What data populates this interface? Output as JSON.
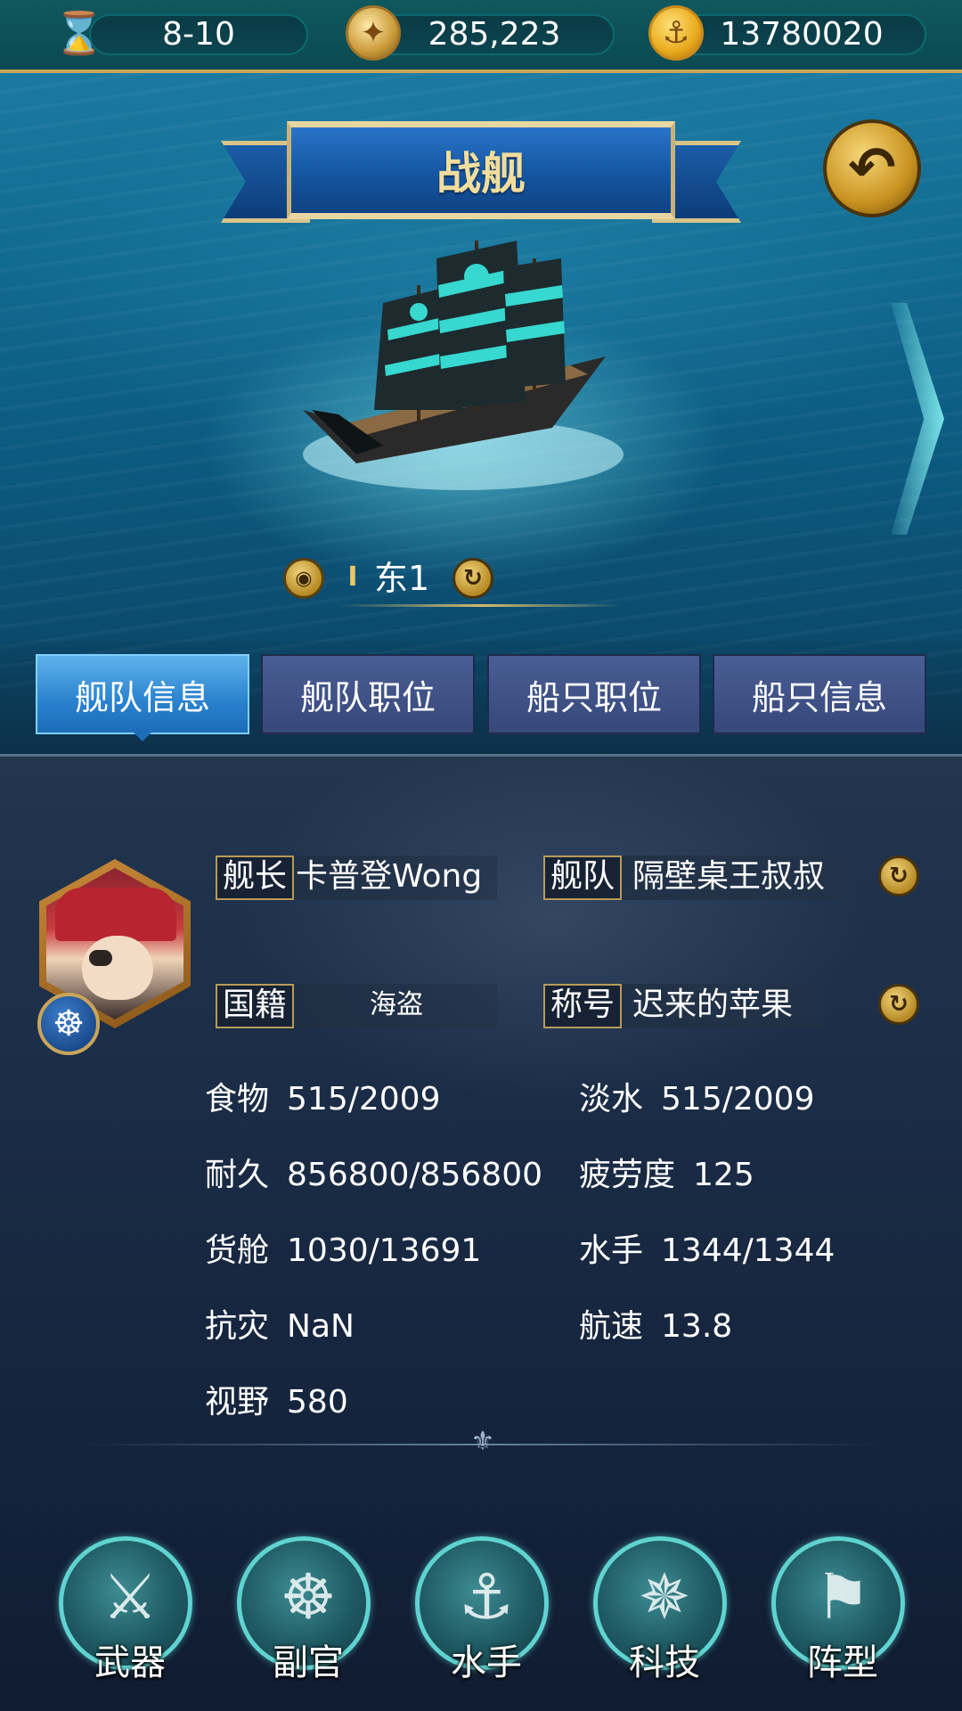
{
  "top_bar": {
    "resources": [
      {
        "icon": "hourglass-icon",
        "value": "8-10"
      },
      {
        "icon": "compass-icon",
        "value": "285,223"
      },
      {
        "icon": "anchor-coin-icon",
        "value": "13780020"
      }
    ]
  },
  "header": {
    "title": "战舰",
    "back_icon": "back-arrow-icon"
  },
  "ship": {
    "name": "东1",
    "rank_mark": "I"
  },
  "tabs": [
    {
      "label": "舰队信息",
      "active": true
    },
    {
      "label": "舰队职位",
      "active": false
    },
    {
      "label": "船只职位",
      "active": false
    },
    {
      "label": "船只信息",
      "active": false
    }
  ],
  "profile": {
    "captain_label": "舰长",
    "captain_value": "卡普登Wong",
    "fleet_label": "舰队",
    "fleet_value": "隔壁桌王叔叔",
    "nationality_label": "国籍",
    "nationality_value": "海盗",
    "title_label": "称号",
    "title_value": "迟来的苹果"
  },
  "stats": {
    "food": {
      "label": "食物",
      "value": "515/2009"
    },
    "water": {
      "label": "淡水",
      "value": "515/2009"
    },
    "durability": {
      "label": "耐久",
      "value": "856800/856800"
    },
    "fatigue": {
      "label": "疲劳度",
      "value": "125"
    },
    "cargo": {
      "label": "货舱",
      "value": "1030/13691"
    },
    "sailors": {
      "label": "水手",
      "value": "1344/1344"
    },
    "disaster_resist": {
      "label": "抗灾",
      "value": "NaN"
    },
    "speed": {
      "label": "航速",
      "value": "13.8"
    },
    "vision": {
      "label": "视野",
      "value": "580"
    }
  },
  "actions": [
    {
      "label": "武器",
      "icon": "sword-icon"
    },
    {
      "label": "副官",
      "icon": "ship-wheel-icon"
    },
    {
      "label": "水手",
      "icon": "hook-icon"
    },
    {
      "label": "科技",
      "icon": "compass-icon"
    },
    {
      "label": "阵型",
      "icon": "flag-icon"
    }
  ],
  "colors": {
    "topbar": "#0b4a52",
    "gold": "#c9a55a",
    "tab_active": "#2a82cf",
    "tab_inactive": "#3f518a",
    "panel": "#1a2b45",
    "action_ring": "#5fd3cf"
  }
}
